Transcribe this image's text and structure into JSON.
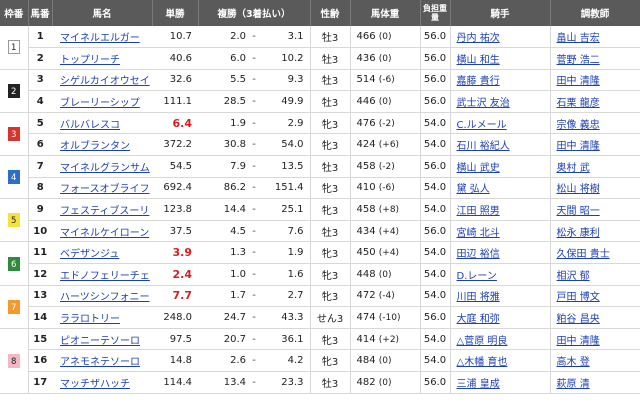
{
  "headers": [
    "枠番",
    "馬番",
    "馬名",
    "単勝",
    "複勝（3着払い）",
    "性齢",
    "馬体重",
    "負担重量",
    "騎手",
    "調教師"
  ],
  "colors": {
    "waku1": "#ffffff",
    "waku2": "#222222",
    "waku3": "#d8332c",
    "waku4": "#2f6dc8",
    "waku5": "#f5e23a",
    "waku6": "#2e8b3e",
    "waku7": "#f29a2e",
    "waku8": "#f5b6c8"
  },
  "rows": [
    {
      "waku": "1",
      "num": "1",
      "name": "マイネルエルガー",
      "odds": "10.7",
      "pl_low": "2.0",
      "dash": "-",
      "pl_high": "3.1",
      "sex": "牡3",
      "wt": "466",
      "diff": "(0)",
      "kg": "56.0",
      "jockey": "丹内 祐次",
      "trainer": "畠山 吉宏",
      "hot": false
    },
    {
      "waku": "",
      "num": "2",
      "name": "トップリーチ",
      "odds": "40.6",
      "pl_low": "6.0",
      "dash": "-",
      "pl_high": "10.2",
      "sex": "牡3",
      "wt": "436",
      "diff": "(0)",
      "kg": "56.0",
      "jockey": "横山 和生",
      "trainer": "菅野 浩二",
      "hot": false
    },
    {
      "waku": "2",
      "num": "3",
      "name": "シゲルカイオウセイ",
      "odds": "32.6",
      "pl_low": "5.5",
      "dash": "-",
      "pl_high": "9.3",
      "sex": "牡3",
      "wt": "514",
      "diff": "(-6)",
      "kg": "56.0",
      "jockey": "嘉藤 貴行",
      "trainer": "田中 清隆",
      "hot": false
    },
    {
      "waku": "",
      "num": "4",
      "name": "ブレーリーシップ",
      "odds": "111.1",
      "pl_low": "28.5",
      "dash": "-",
      "pl_high": "49.9",
      "sex": "牡3",
      "wt": "446",
      "diff": "(0)",
      "kg": "56.0",
      "jockey": "武士沢 友治",
      "trainer": "石栗 龍彦",
      "hot": false
    },
    {
      "waku": "3",
      "num": "5",
      "name": "バルバレスコ",
      "odds": "6.4",
      "pl_low": "1.9",
      "dash": "-",
      "pl_high": "2.9",
      "sex": "牝3",
      "wt": "476",
      "diff": "(-2)",
      "kg": "54.0",
      "jockey": "C.ルメール",
      "trainer": "宗像 義忠",
      "hot": true
    },
    {
      "waku": "",
      "num": "6",
      "name": "オルブランタン",
      "odds": "372.2",
      "pl_low": "30.8",
      "dash": "-",
      "pl_high": "54.0",
      "sex": "牝3",
      "wt": "424",
      "diff": "(+6)",
      "kg": "54.0",
      "jockey": "石川 裕紀人",
      "trainer": "田中 清隆",
      "hot": false
    },
    {
      "waku": "4",
      "num": "7",
      "name": "マイネルグランサム",
      "odds": "54.5",
      "pl_low": "7.9",
      "dash": "-",
      "pl_high": "13.5",
      "sex": "牡3",
      "wt": "458",
      "diff": "(-2)",
      "kg": "56.0",
      "jockey": "横山 武史",
      "trainer": "奥村 武",
      "hot": false
    },
    {
      "waku": "",
      "num": "8",
      "name": "フォースオブライフ",
      "odds": "692.4",
      "pl_low": "86.2",
      "dash": "-",
      "pl_high": "151.4",
      "sex": "牝3",
      "wt": "410",
      "diff": "(-6)",
      "kg": "54.0",
      "jockey": "黛 弘人",
      "trainer": "松山 将樹",
      "hot": false
    },
    {
      "waku": "5",
      "num": "9",
      "name": "フェスティブスーリ",
      "odds": "123.8",
      "pl_low": "14.4",
      "dash": "-",
      "pl_high": "25.1",
      "sex": "牝3",
      "wt": "458",
      "diff": "(+8)",
      "kg": "54.0",
      "jockey": "江田 照男",
      "trainer": "天間 昭一",
      "hot": false
    },
    {
      "waku": "",
      "num": "10",
      "name": "マイネルケイローン",
      "odds": "37.5",
      "pl_low": "4.5",
      "dash": "-",
      "pl_high": "7.6",
      "sex": "牡3",
      "wt": "434",
      "diff": "(+4)",
      "kg": "56.0",
      "jockey": "宮崎 北斗",
      "trainer": "松永 康利",
      "hot": false
    },
    {
      "waku": "6",
      "num": "11",
      "name": "ベデザンジュ",
      "odds": "3.9",
      "pl_low": "1.3",
      "dash": "-",
      "pl_high": "1.9",
      "sex": "牝3",
      "wt": "450",
      "diff": "(+4)",
      "kg": "54.0",
      "jockey": "田辺 裕信",
      "trainer": "久保田 貴士",
      "hot": true
    },
    {
      "waku": "",
      "num": "12",
      "name": "エドノフェリーチェ",
      "odds": "2.4",
      "pl_low": "1.0",
      "dash": "-",
      "pl_high": "1.6",
      "sex": "牝3",
      "wt": "448",
      "diff": "(0)",
      "kg": "54.0",
      "jockey": "D.レーン",
      "trainer": "相沢 郁",
      "hot": true
    },
    {
      "waku": "7",
      "num": "13",
      "name": "ハーツシンフォニー",
      "odds": "7.7",
      "pl_low": "1.7",
      "dash": "-",
      "pl_high": "2.7",
      "sex": "牝3",
      "wt": "472",
      "diff": "(-4)",
      "kg": "54.0",
      "jockey": "川田 将雅",
      "trainer": "戸田 博文",
      "hot": true
    },
    {
      "waku": "",
      "num": "14",
      "name": "ララロトリー",
      "odds": "248.0",
      "pl_low": "24.7",
      "dash": "-",
      "pl_high": "43.3",
      "sex": "せん3",
      "wt": "474",
      "diff": "(-10)",
      "kg": "56.0",
      "jockey": "大庭 和弥",
      "trainer": "粕谷 昌央",
      "hot": false
    },
    {
      "waku": "8",
      "num": "15",
      "name": "ピオニーテソーロ",
      "odds": "97.5",
      "pl_low": "20.7",
      "dash": "-",
      "pl_high": "36.1",
      "sex": "牝3",
      "wt": "414",
      "diff": "(+2)",
      "kg": "54.0",
      "jockey": "△菅原 明良",
      "trainer": "田中 清隆",
      "hot": false
    },
    {
      "waku": "",
      "num": "16",
      "name": "アネモネテソーロ",
      "odds": "14.8",
      "pl_low": "2.6",
      "dash": "-",
      "pl_high": "4.2",
      "sex": "牝3",
      "wt": "484",
      "diff": "(0)",
      "kg": "54.0",
      "jockey": "△木幡 育也",
      "trainer": "高木 登",
      "hot": false
    },
    {
      "waku": "",
      "num": "17",
      "name": "マッチザハッチ",
      "odds": "114.4",
      "pl_low": "13.4",
      "dash": "-",
      "pl_high": "23.3",
      "sex": "牡3",
      "wt": "482",
      "diff": "(0)",
      "kg": "56.0",
      "jockey": "三浦 皇成",
      "trainer": "萩原 清",
      "hot": false
    }
  ]
}
